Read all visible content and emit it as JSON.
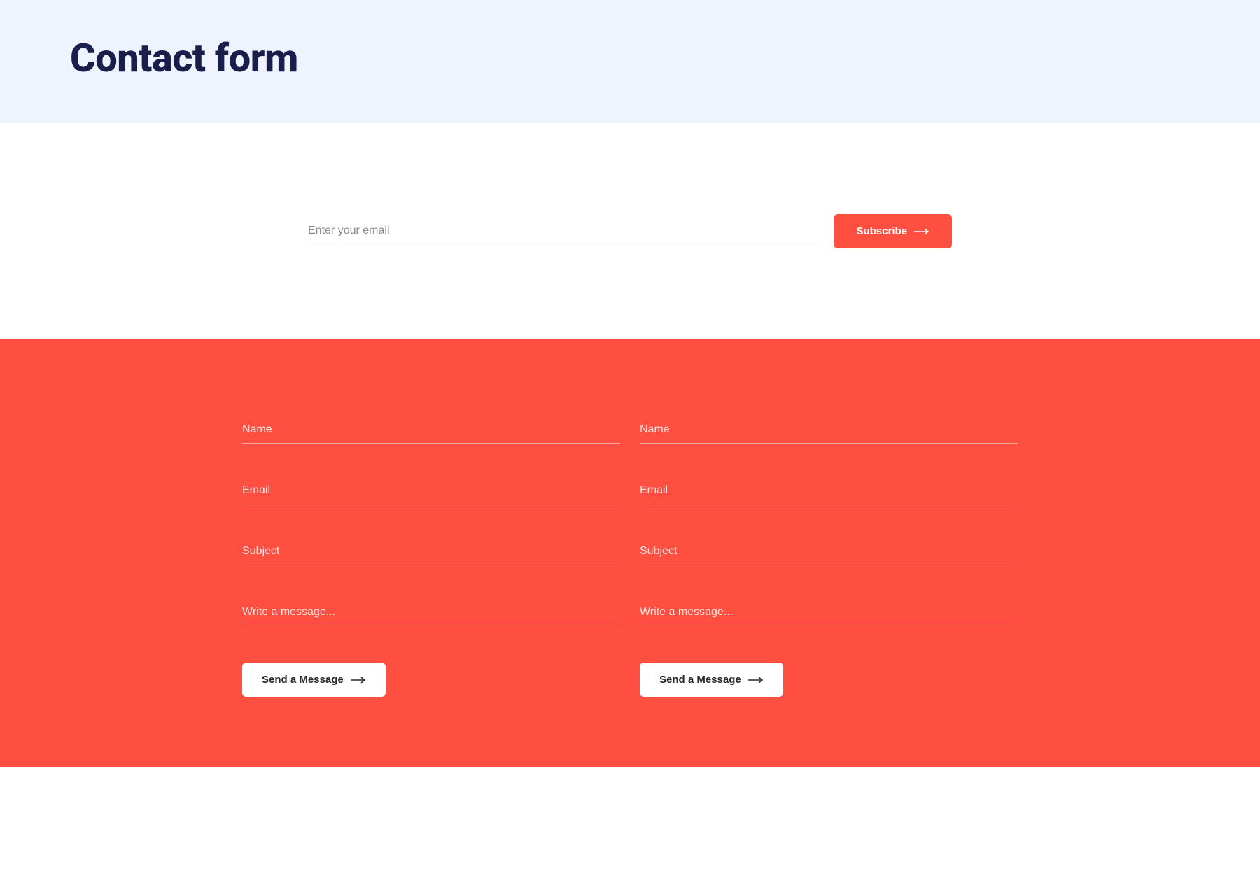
{
  "header": {
    "title": "Contact form"
  },
  "subscribe": {
    "email_placeholder": "Enter your email",
    "button_label": "Subscribe"
  },
  "contact": {
    "forms": [
      {
        "name_placeholder": "Name",
        "email_placeholder": "Email",
        "subject_placeholder": "Subject",
        "message_placeholder": "Write a message...",
        "button_label": "Send a Message"
      },
      {
        "name_placeholder": "Name",
        "email_placeholder": "Email",
        "subject_placeholder": "Subject",
        "message_placeholder": "Write a message...",
        "button_label": "Send a Message"
      }
    ]
  },
  "colors": {
    "accent": "#ff4f40",
    "header_bg": "#eff3fd",
    "title": "#1a1e4a",
    "white": "#ffffff"
  }
}
